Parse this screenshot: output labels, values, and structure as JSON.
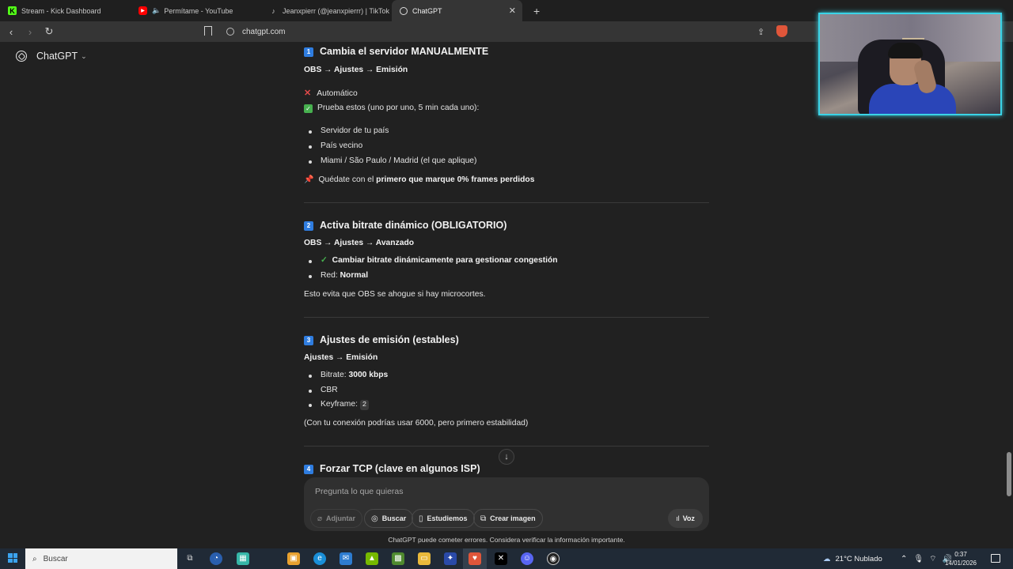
{
  "browser": {
    "tabs": [
      {
        "title": "Stream - Kick Dashboard",
        "icon": "kick-icon",
        "color": "#53fc18"
      },
      {
        "title": "Permítame - YouTube",
        "icon": "youtube-icon",
        "color": "#ff0000"
      },
      {
        "title": "Jeanxpierr (@jeanxpierrr) | TikTok",
        "icon": "tiktok-icon",
        "color": "#ffffff"
      },
      {
        "title": "ChatGPT",
        "icon": "chatgpt-icon",
        "color": "#ffffff",
        "active": true
      }
    ],
    "url": "chatgpt.com"
  },
  "sidebar": {
    "brand": "ChatGPT"
  },
  "content": {
    "s1": {
      "num": "1",
      "title": "Cambia el servidor MANUALMENTE",
      "path": "OBS → Ajustes → Emisión",
      "bad": "Automático",
      "good": "Prueba estos (uno por uno, 5 min cada uno):",
      "items": [
        "Servidor de tu país",
        "País vecino",
        "Miami / São Paulo / Madrid (el que aplique)"
      ],
      "tip_pre": "Quédate con el ",
      "tip_bold": "primero que marque 0% frames perdidos"
    },
    "s2": {
      "num": "2",
      "title": "Activa bitrate dinámico (OBLIGATORIO)",
      "path": "OBS → Ajustes → Avanzado",
      "item1": "Cambiar bitrate dinámicamente para gestionar congestión",
      "item2_pre": "Red: ",
      "item2_bold": "Normal",
      "note": "Esto evita que OBS se ahogue si hay microcortes."
    },
    "s3": {
      "num": "3",
      "title": "Ajustes de emisión (estables)",
      "path": "Ajustes → Emisión",
      "bitrate_pre": "Bitrate: ",
      "bitrate_bold": "3000 kbps",
      "cbr": "CBR",
      "keyframe_pre": "Keyframe: ",
      "keyframe_code": "2",
      "note": "(Con tu conexión podrías usar 6000, pero primero estabilidad)"
    },
    "s4": {
      "num": "4",
      "title": "Forzar TCP (clave en algunos ISP)"
    }
  },
  "composer": {
    "placeholder": "Pregunta lo que quieras",
    "attach": "Adjuntar",
    "search": "Buscar",
    "study": "Estudiemos",
    "image": "Crear imagen",
    "voice": "Voz"
  },
  "disclaimer": "ChatGPT puede cometer errores. Considera verificar la información importante.",
  "taskbar": {
    "search_placeholder": "Buscar",
    "weather": "21°C  Nublado",
    "time": "0:37",
    "date": "14/01/2026"
  }
}
